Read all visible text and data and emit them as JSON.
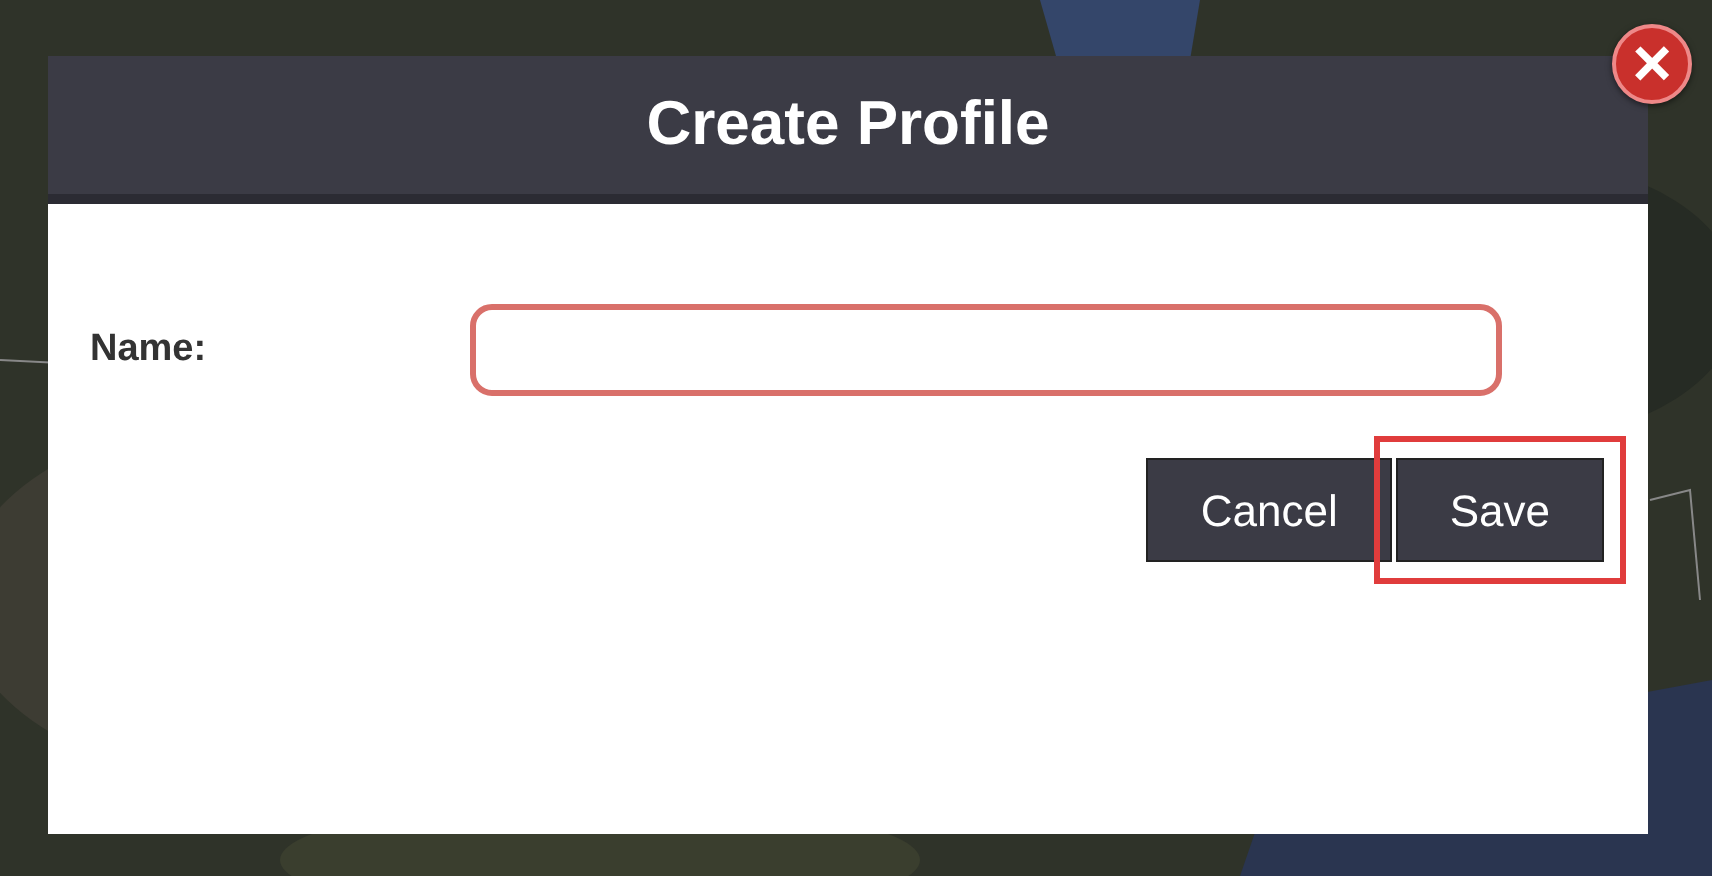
{
  "dialog": {
    "title": "Create Profile",
    "close_icon": "×",
    "fields": [
      {
        "label": "Name:"
      }
    ],
    "buttons": [
      {
        "label": "Cancel",
        "highlighted": false
      },
      {
        "label": "Save",
        "highlighted": true
      }
    ]
  }
}
